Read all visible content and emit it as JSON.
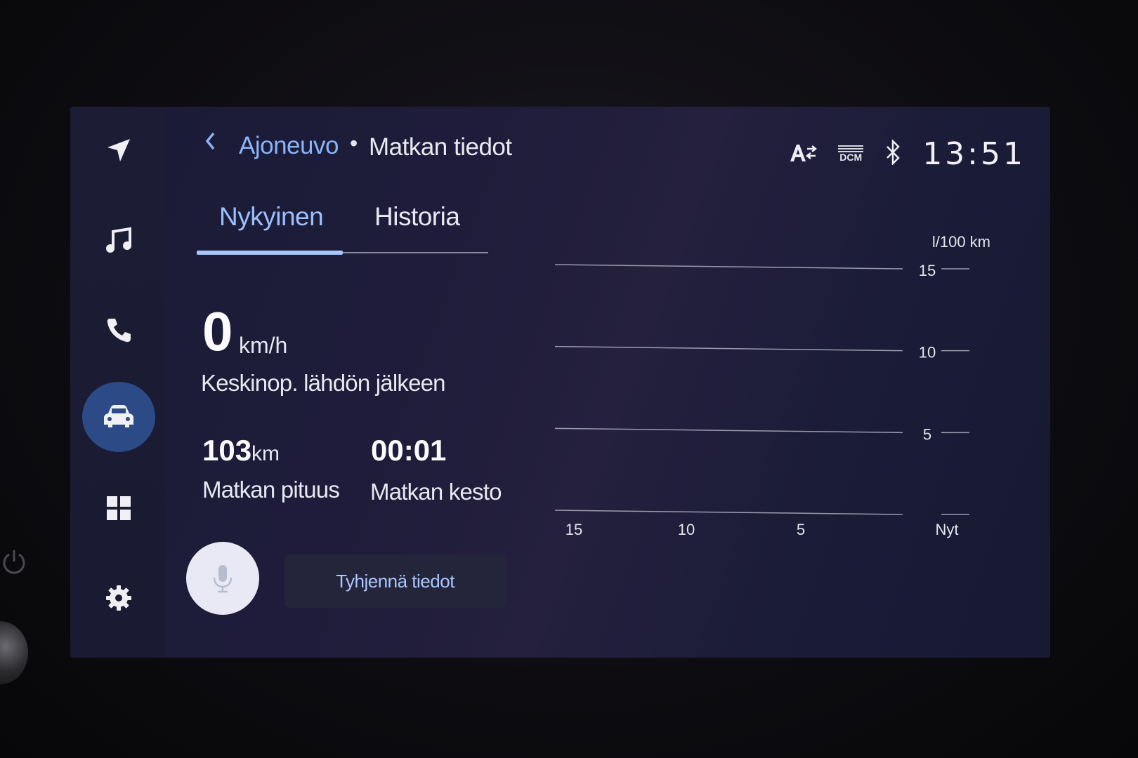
{
  "header": {
    "back_icon": "chevron-left-icon",
    "breadcrumb_link": "Ajoneuvo",
    "separator": "•",
    "title": "Matkan tiedot"
  },
  "status_bar": {
    "icons": [
      "text-size-icon",
      "dcm-icon",
      "bluetooth-icon"
    ],
    "dcm_label": "DCM",
    "clock": "13:51"
  },
  "sidebar": {
    "items": [
      {
        "name": "navigation",
        "icon": "navigation-arrow-icon",
        "active": false
      },
      {
        "name": "music",
        "icon": "music-note-icon",
        "active": false
      },
      {
        "name": "phone",
        "icon": "phone-icon",
        "active": false
      },
      {
        "name": "vehicle",
        "icon": "car-icon",
        "active": true
      },
      {
        "name": "apps",
        "icon": "grid-icon",
        "active": false
      },
      {
        "name": "settings",
        "icon": "gear-icon",
        "active": false
      }
    ]
  },
  "tabs": [
    {
      "label": "Nykyinen",
      "active": true
    },
    {
      "label": "Historia",
      "active": false
    }
  ],
  "stats": {
    "avg_speed_value": "0",
    "avg_speed_unit": "km/h",
    "avg_speed_label": "Keskinop. lähdön jälkeen",
    "distance_value": "103",
    "distance_unit": "km",
    "distance_label": "Matkan pituus",
    "duration_value": "00:01",
    "duration_label": "Matkan kesto"
  },
  "actions": {
    "mic_icon": "microphone-icon",
    "clear_label": "Tyhjennä tiedot"
  },
  "colors": {
    "accent": "#8ab4f8",
    "active_nav": "#2b4a86",
    "screen_bg": "#1e1c3a"
  },
  "chart_data": {
    "type": "bar",
    "unit_label": "l/100 km",
    "y_ticks": [
      "15",
      "10",
      "5"
    ],
    "x_ticks": [
      "15",
      "10",
      "5",
      "Nyt"
    ],
    "ylim": [
      0,
      15
    ],
    "grid": true,
    "series": [
      {
        "values": []
      }
    ]
  }
}
